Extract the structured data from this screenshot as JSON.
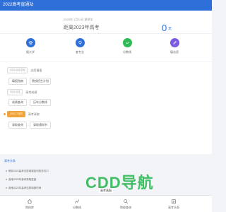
{
  "app": {
    "title": "2022高考直通站"
  },
  "countdown": {
    "date_line": "2026年 1月31日 星期五",
    "since_text": "距离2023年高考",
    "days": "0",
    "unit": "天"
  },
  "entries": [
    {
      "label": "报大学",
      "color": "#2f6fd9",
      "icon": "school-icon"
    },
    {
      "label": "查专业",
      "color": "#2f6fd9",
      "icon": "bulb-icon"
    },
    {
      "label": "分数线",
      "color": "#2fb957",
      "icon": "trend-icon"
    },
    {
      "label": "填志愿",
      "color": "#7b5be0",
      "icon": "pen-icon"
    }
  ],
  "timeline": [
    {
      "date": "2022-6月中旬",
      "title": "志愿填报",
      "active": false,
      "buttons": [
        "填报指南",
        "院校招生计划"
      ]
    },
    {
      "date": "2022-6月",
      "title": "高考成绩",
      "active": false,
      "buttons": [
        "成绩查询",
        "历年分数线"
      ]
    },
    {
      "date": "2022-7月初",
      "title": "高考录取",
      "active": true,
      "buttons": [
        "录取查询",
        "录取通知书"
      ]
    }
  ],
  "news": {
    "label": "高考头条",
    "items": [
      "教你2022高考志愿填报如何防范坑口",
      "各地2022年高考录取进度",
      "各地2022年高考志愿填报时间"
    ]
  },
  "watermark": {
    "text": "CDD导航"
  },
  "stamp": {
    "text": "高考选报"
  },
  "tabbar": [
    {
      "label": "院校库",
      "icon": "home-icon"
    },
    {
      "label": "分数线",
      "icon": "chart-icon"
    },
    {
      "label": "院校查询",
      "icon": "search-icon"
    },
    {
      "label": "高考头条",
      "icon": "news-icon"
    }
  ],
  "colors": {
    "primary": "#2f6fd9",
    "accent": "#f0a33a",
    "green": "#2fb957"
  }
}
